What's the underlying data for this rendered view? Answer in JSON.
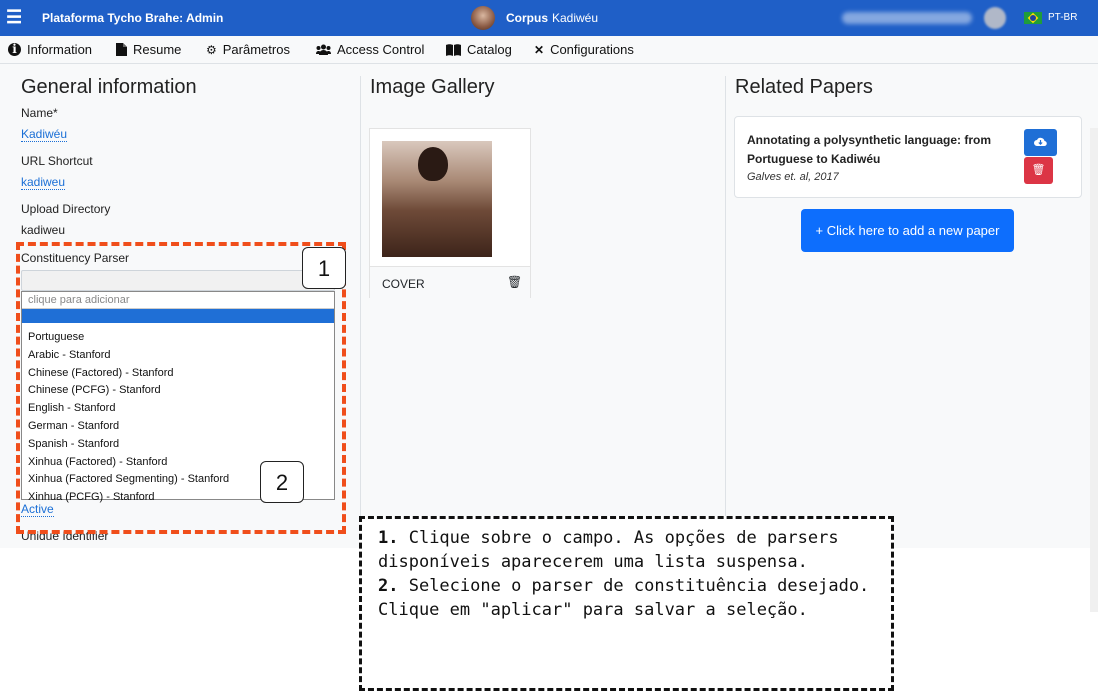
{
  "topbar": {
    "menu_icon": "☰",
    "brand": "Plataforma Tycho Brahe: Admin",
    "corpus_prefix": "Corpus",
    "corpus_name": "Kadiwéu",
    "language": "PT-BR"
  },
  "nav": [
    {
      "label": "Information",
      "icon": "info-icon"
    },
    {
      "label": "Resume",
      "icon": "file-icon"
    },
    {
      "label": "Parâmetros",
      "icon": "gears-icon"
    },
    {
      "label": "Access Control",
      "icon": "users-icon"
    },
    {
      "label": "Catalog",
      "icon": "book-icon"
    },
    {
      "label": "Configurations",
      "icon": "tools-icon"
    }
  ],
  "general": {
    "heading": "General information",
    "name_label": "Name*",
    "name_value": "Kadiwéu",
    "url_label": "URL Shortcut",
    "url_value": "kadiweu",
    "upload_label": "Upload Directory",
    "upload_value": "kadiweu",
    "parser_label": "Constituency Parser",
    "dropdown_placeholder": "clique para adicionar",
    "parser_options": [
      "Portuguese",
      "Arabic - Stanford",
      "Chinese (Factored) - Stanford",
      "Chinese (PCFG) - Stanford",
      "English - Stanford",
      "German - Stanford",
      "Spanish - Stanford",
      "Xinhua (Factored) - Stanford",
      "Xinhua (Factored Segmenting) - Stanford",
      "Xinhua (PCFG) - Stanford"
    ],
    "status_value": "Active",
    "unique_label": "Unique Identifier"
  },
  "gallery": {
    "heading": "Image Gallery",
    "cover_label": "COVER"
  },
  "papers": {
    "heading": "Related Papers",
    "items": [
      {
        "title": "Annotating a polysynthetic language: from Portuguese to Kadiwéu",
        "authors": "Galves et. al, 2017"
      }
    ],
    "add_button": "Click here to add a new paper",
    "add_prefix": "+"
  },
  "annotations": {
    "marker_1": "1",
    "marker_2": "2",
    "step1_num": "1.",
    "step1_text": " Clique sobre o campo. As opções de parsers disponíveis aparecerem uma lista suspensa.",
    "step2_num": "2.",
    "step2_text": " Selecione o parser de constituência desejado. Clique em \"aplicar\" para salvar a seleção."
  },
  "colors": {
    "topbar": "#1f5fc7",
    "link": "#1a6fd6",
    "primary": "#0d6efd",
    "danger": "#dc3545",
    "highlight_border": "#f04e1b"
  }
}
